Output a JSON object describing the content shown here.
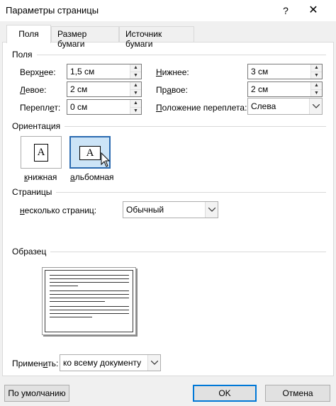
{
  "window": {
    "title": "Параметры страницы",
    "help_glyph": "?",
    "close_glyph": "✕"
  },
  "tabs": [
    {
      "label": "Поля",
      "active": true
    },
    {
      "label": "Размер бумаги",
      "active": false
    },
    {
      "label": "Источник бумаги",
      "active": false
    }
  ],
  "margins": {
    "section_label": "Поля",
    "top": {
      "label_pre": "Верх",
      "label_u": "н",
      "label_post": "ее:",
      "value": "1,5 см"
    },
    "bottom": {
      "label_pre": "",
      "label_u": "Н",
      "label_post": "ижнее:",
      "value": "3 см"
    },
    "left": {
      "label_pre": "",
      "label_u": "Л",
      "label_post": "евое:",
      "value": "2 см"
    },
    "right": {
      "label_pre": "Пр",
      "label_u": "а",
      "label_post": "вое:",
      "value": "2 см"
    },
    "gutter": {
      "label_pre": "Перепл",
      "label_u": "е",
      "label_post": "т:",
      "value": "0 см"
    },
    "gutter_position": {
      "label_pre": "",
      "label_u": "П",
      "label_post": "оложение переплета:",
      "value": "Слева"
    }
  },
  "orientation": {
    "section_label": "Ориентация",
    "portrait": {
      "label_pre": "",
      "label_u": "к",
      "label_post": "нижная",
      "glyph": "A",
      "selected": false
    },
    "landscape": {
      "label_pre": "",
      "label_u": "а",
      "label_post": "льбомная",
      "glyph": "A",
      "selected": true
    }
  },
  "pages": {
    "section_label": "Страницы",
    "multiple_label_pre": "",
    "multiple_label_u": "н",
    "multiple_label_post": "есколько страниц:",
    "multiple_value": "Обычный"
  },
  "preview": {
    "section_label": "Образец"
  },
  "apply": {
    "label_pre": "Примен",
    "label_u": "и",
    "label_post": "ть:",
    "value": "ко всему документу"
  },
  "buttons": {
    "default_label": "По умолчанию",
    "ok_label": "OK",
    "cancel_label": "Отмена"
  }
}
